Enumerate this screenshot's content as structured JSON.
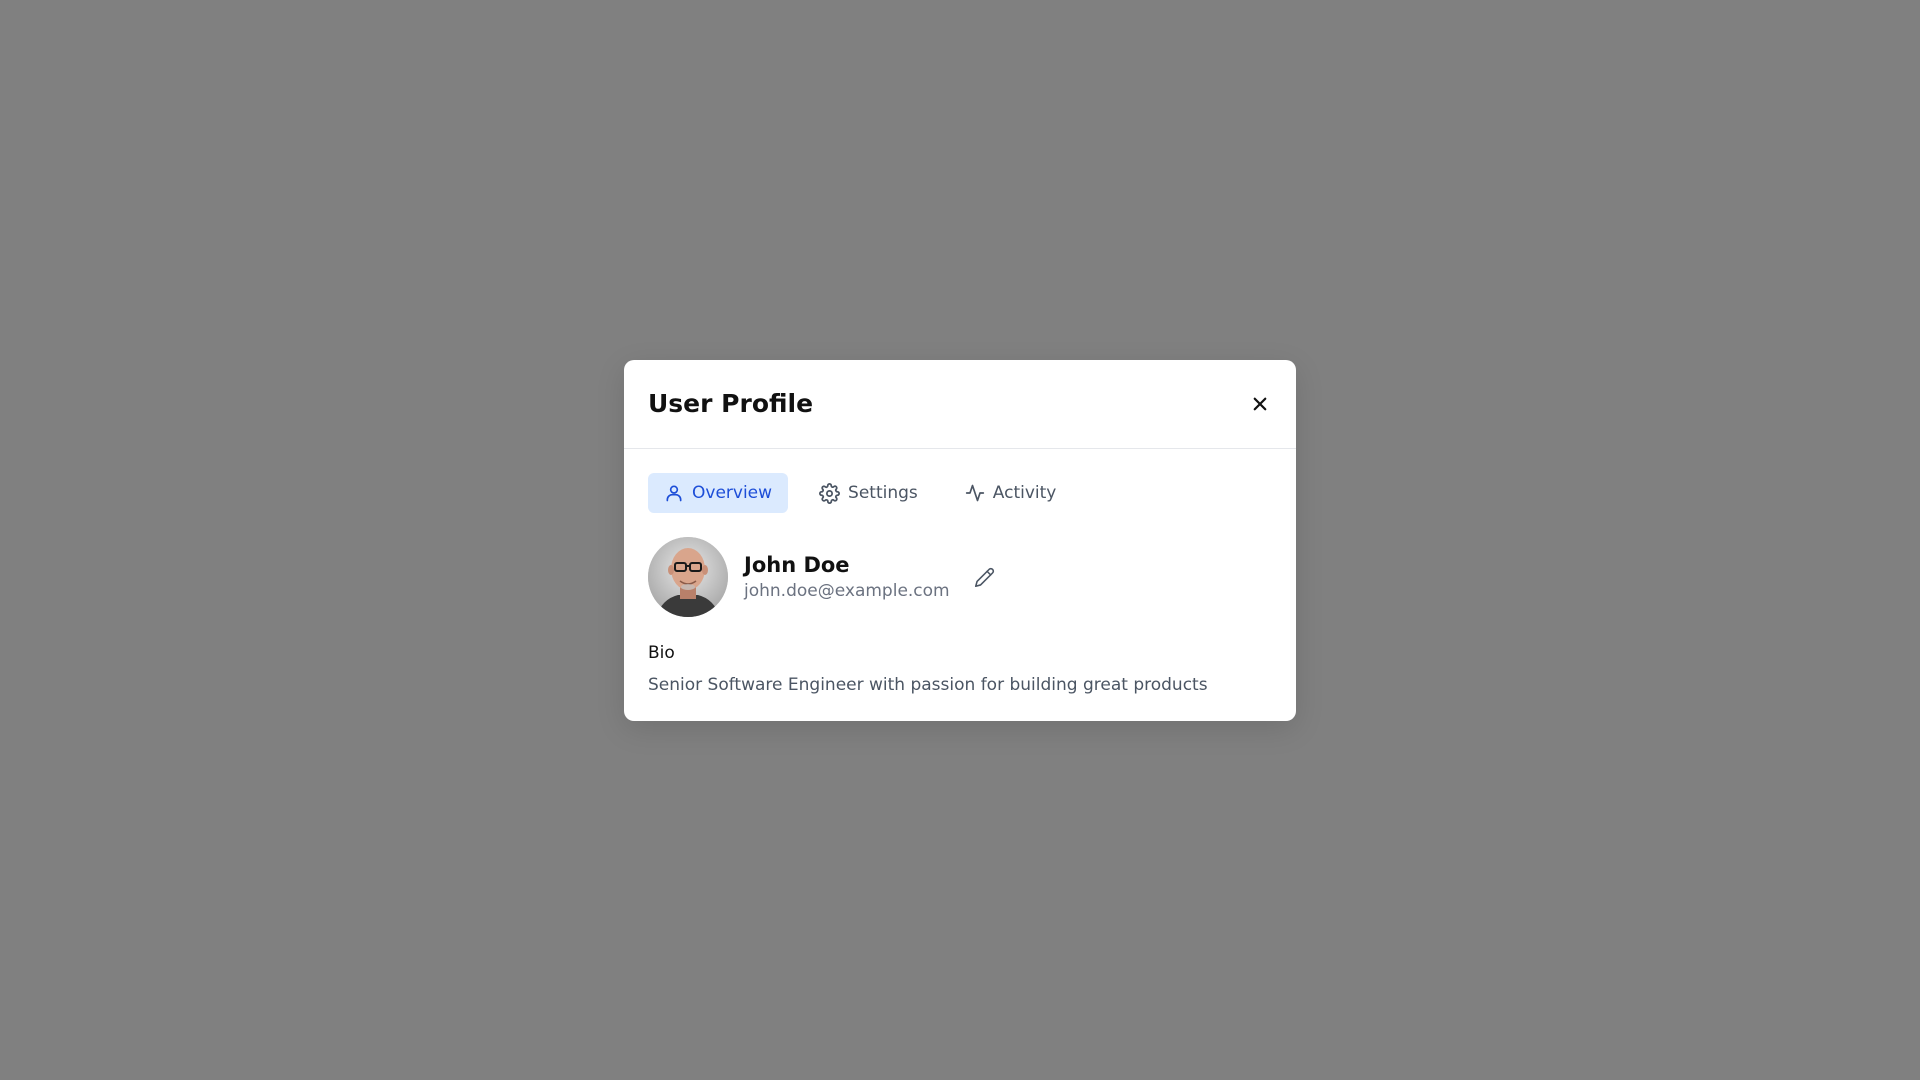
{
  "modal": {
    "title": "User Profile",
    "close_icon": "close-icon"
  },
  "tabs": [
    {
      "label": "Overview",
      "icon": "user-icon",
      "active": true
    },
    {
      "label": "Settings",
      "icon": "gear-icon",
      "active": false
    },
    {
      "label": "Activity",
      "icon": "activity-icon",
      "active": false
    }
  ],
  "profile": {
    "name": "John Doe",
    "email": "john.doe@example.com",
    "avatar_icon": "avatar",
    "edit_icon": "pencil-icon"
  },
  "bio": {
    "label": "Bio",
    "text": "Senior Software Engineer with passion for building great products"
  },
  "colors": {
    "backdrop": "#808080",
    "accent": "#1d4ed8",
    "accent_bg": "#dbeafe",
    "muted_text": "#6b7280"
  }
}
